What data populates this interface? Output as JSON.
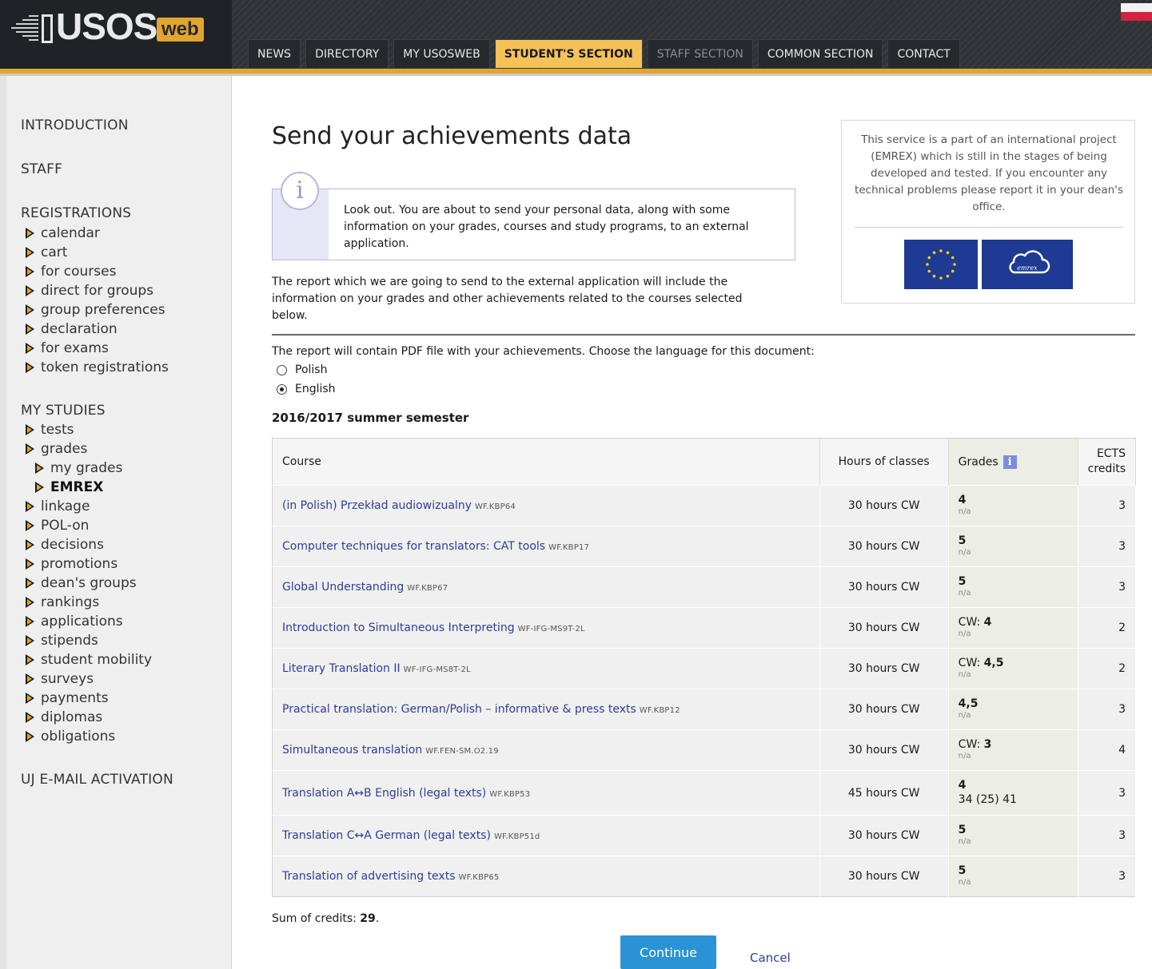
{
  "app": {
    "logo_text": "USOS",
    "logo_badge": "web"
  },
  "nav": {
    "tabs": [
      {
        "label": "NEWS",
        "state": "normal"
      },
      {
        "label": "DIRECTORY",
        "state": "normal"
      },
      {
        "label": "MY USOSWEB",
        "state": "normal"
      },
      {
        "label": "STUDENT'S SECTION",
        "state": "active"
      },
      {
        "label": "STAFF SECTION",
        "state": "disabled"
      },
      {
        "label": "COMMON SECTION",
        "state": "normal"
      },
      {
        "label": "CONTACT",
        "state": "normal"
      }
    ]
  },
  "sidebar": {
    "introduction": "INTRODUCTION",
    "staff": "STAFF",
    "registrations": "REGISTRATIONS",
    "registrations_items": [
      "calendar",
      "cart",
      "for courses",
      "direct for groups",
      "group preferences",
      "declaration",
      "for exams",
      "token registrations"
    ],
    "my_studies": "MY STUDIES",
    "my_studies_items": {
      "tests": "tests",
      "grades": "grades",
      "my_grades": "my grades",
      "emrex": "EMREX",
      "rest": [
        "linkage",
        "POL-on",
        "decisions",
        "promotions",
        "dean's groups",
        "rankings",
        "applications",
        "stipends",
        "student mobility",
        "surveys",
        "payments",
        "diplomas",
        "obligations"
      ]
    },
    "email_activation": "UJ E-MAIL ACTIVATION"
  },
  "main": {
    "title": "Send your achievements data",
    "notice": "Look out. You are about to send your personal data, along with some information on your grades, courses and study programs, to an external application.",
    "report_description": "The report which we are going to send to the external application will include the information on your grades and other achievements related to the courses selected below.",
    "emrex_info": "This service is a part of an international project (EMREX) which is still in the stages of being developed and tested. If you encounter any technical problems please report it in your dean's office.",
    "language_prompt": "The report will contain PDF file with your achievements. Choose the language for this document:",
    "language_options": [
      {
        "label": "Polish",
        "checked": false
      },
      {
        "label": "English",
        "checked": true
      }
    ],
    "semester": "2016/2017 summer semester",
    "sum_label": "Sum of credits: ",
    "sum_value": "29",
    "sum_suffix": ".",
    "continue_label": "Continue",
    "cancel_label": "Cancel"
  },
  "table": {
    "headers": {
      "course": "Course",
      "hours": "Hours of classes",
      "grades": "Grades",
      "ects_line1": "ECTS",
      "ects_line2": "credits"
    },
    "rows": [
      {
        "name": "(in Polish) Przekład audiowizualny",
        "code": "WF.KBP64",
        "hours": "30 hours CW",
        "grade_prefix": "",
        "grade": "4",
        "grade_sub": "n/a",
        "ects": "3"
      },
      {
        "name": "Computer techniques for translators: CAT tools",
        "code": "WF.KBP17",
        "hours": "30 hours CW",
        "grade_prefix": "",
        "grade": "5",
        "grade_sub": "n/a",
        "ects": "3"
      },
      {
        "name": "Global Understanding",
        "code": "WF.KBP67",
        "hours": "30 hours CW",
        "grade_prefix": "",
        "grade": "5",
        "grade_sub": "n/a",
        "ects": "3"
      },
      {
        "name": "Introduction to Simultaneous Interpreting",
        "code": "WF-IFG-MS9T-2L",
        "hours": "30 hours CW",
        "grade_prefix": "CW: ",
        "grade": "4",
        "grade_sub": "n/a",
        "ects": "2"
      },
      {
        "name": "Literary Translation II",
        "code": "WF-IFG-MS8T-2L",
        "hours": "30 hours CW",
        "grade_prefix": "CW: ",
        "grade": "4,5",
        "grade_sub": "n/a",
        "ects": "2"
      },
      {
        "name": "Practical translation: German/Polish – informative & press texts",
        "code": "WF.KBP12",
        "hours": "30 hours CW",
        "grade_prefix": "",
        "grade": "4,5",
        "grade_sub": "n/a",
        "ects": "3"
      },
      {
        "name": "Simultaneous translation",
        "code": "WF.FEN-SM.O2.19",
        "hours": "30 hours CW",
        "grade_prefix": "CW: ",
        "grade": "3",
        "grade_sub": "n/a",
        "ects": "4"
      },
      {
        "name": "Translation A↔B English (legal texts)",
        "code": "WF.KBP53",
        "hours": "45 hours CW",
        "grade_prefix": "",
        "grade": "4",
        "grade_sub": "34 (25) 41",
        "ects": "3"
      },
      {
        "name": "Translation C↔A German (legal texts)",
        "code": "WF.KBP51d",
        "hours": "30 hours CW",
        "grade_prefix": "",
        "grade": "5",
        "grade_sub": "n/a",
        "ects": "3"
      },
      {
        "name": "Translation of advertising texts",
        "code": "WF.KBP65",
        "hours": "30 hours CW",
        "grade_prefix": "",
        "grade": "5",
        "grade_sub": "n/a",
        "ects": "3"
      }
    ]
  },
  "colors": {
    "accent": "#e1a530",
    "active_tab": "#f4c257",
    "link": "#2e3d9a",
    "button": "#2a93d5",
    "eu_blue": "#1f3a93"
  }
}
